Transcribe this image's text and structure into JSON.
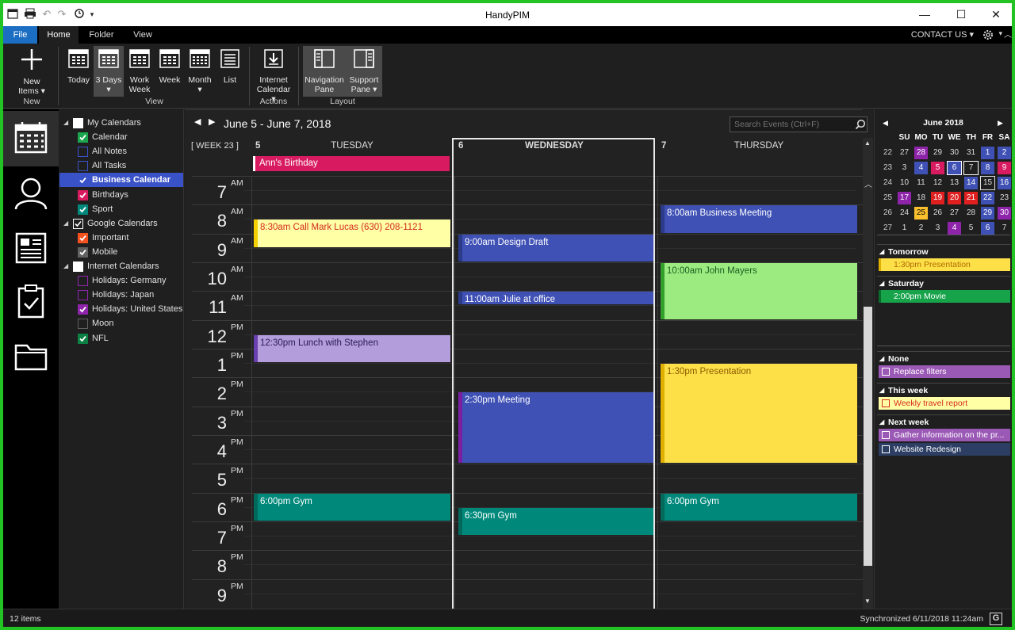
{
  "window": {
    "title": "HandyPIM",
    "controls": {
      "minimize": "—",
      "maximize": "☐",
      "close": "✕"
    }
  },
  "menu": {
    "tabs": {
      "file": "File",
      "home": "Home",
      "folder": "Folder",
      "view": "View"
    },
    "contact_us": "CONTACT US"
  },
  "ribbon": {
    "new_items_1": "New",
    "new_items_2": "Items",
    "new_group": "New",
    "today": "Today",
    "three_days": "3 Days",
    "work_week_1": "Work",
    "work_week_2": "Week",
    "week": "Week",
    "month": "Month",
    "list": "List",
    "view_group": "View",
    "internet_cal_1": "Internet",
    "internet_cal_2": "Calendar",
    "actions_group": "Actions",
    "nav_pane_1": "Navigation",
    "nav_pane_2": "Pane",
    "support_pane_1": "Support",
    "support_pane_2": "Pane",
    "layout_group": "Layout"
  },
  "calendars": [
    {
      "label": "My Calendars",
      "group": true,
      "checked": false,
      "color": "#ffffff"
    },
    {
      "label": "Calendar",
      "checked": true,
      "color": "#19a64e"
    },
    {
      "label": "All Notes",
      "checked": false,
      "color": "#3a52c7"
    },
    {
      "label": "All Tasks",
      "checked": false,
      "color": "#3a52c7"
    },
    {
      "label": "Business Calendar",
      "checked": true,
      "color": "#3a52c7",
      "selected": true
    },
    {
      "label": "Birthdays",
      "checked": true,
      "color": "#d81b60"
    },
    {
      "label": "Sport",
      "checked": true,
      "color": "#00897b"
    },
    {
      "label": "Google Calendars",
      "group": true,
      "checked": true,
      "color": "#ffffff"
    },
    {
      "label": "Important",
      "checked": true,
      "color": "#f4511e"
    },
    {
      "label": "Mobile",
      "checked": true,
      "color": "#616161"
    },
    {
      "label": "Internet Calendars",
      "group": true,
      "checked": false,
      "color": "#ffffff"
    },
    {
      "label": "Holidays: Germany",
      "checked": false,
      "color": "#8e24aa"
    },
    {
      "label": "Holidays: Japan",
      "checked": false,
      "color": "#8e24aa"
    },
    {
      "label": "Holidays: United States",
      "checked": true,
      "color": "#8e24aa"
    },
    {
      "label": "Moon",
      "checked": false,
      "color": "#616161"
    },
    {
      "label": "NFL",
      "checked": true,
      "color": "#0b8043"
    }
  ],
  "main": {
    "date_range": "June 5 - June 7, 2018",
    "search_placeholder": "Search Events (Ctrl+F)",
    "week_label": "[ WEEK 23 ]",
    "days": [
      {
        "num": "5",
        "name": "TUESDAY"
      },
      {
        "num": "6",
        "name": "WEDNESDAY"
      },
      {
        "num": "7",
        "name": "THURSDAY"
      }
    ],
    "hours": [
      {
        "num": "7",
        "ampm": "AM"
      },
      {
        "num": "8",
        "ampm": "AM"
      },
      {
        "num": "9",
        "ampm": "AM"
      },
      {
        "num": "10",
        "ampm": "AM"
      },
      {
        "num": "11",
        "ampm": "AM"
      },
      {
        "num": "12",
        "ampm": "PM"
      },
      {
        "num": "1",
        "ampm": "PM"
      },
      {
        "num": "2",
        "ampm": "PM"
      },
      {
        "num": "3",
        "ampm": "PM"
      },
      {
        "num": "4",
        "ampm": "PM"
      },
      {
        "num": "5",
        "ampm": "PM"
      },
      {
        "num": "6",
        "ampm": "PM"
      },
      {
        "num": "7",
        "ampm": "PM"
      },
      {
        "num": "8",
        "ampm": "PM"
      },
      {
        "num": "9",
        "ampm": "PM"
      }
    ],
    "all_day_event": "Ann's Birthday",
    "events": [
      {
        "label": "8:30am Call Mark Lucas  (630) 208-1121",
        "bg": "#ffffa6",
        "fg": "#d42a1c",
        "stripe": "#f5d000"
      },
      {
        "label": "12:30pm Lunch with Stephen",
        "bg": "#b39ddb",
        "fg": "#2a1a55",
        "stripe": "#6a3fb0"
      },
      {
        "label": "6:00pm Gym",
        "bg": "#00897b",
        "fg": "#ffffff",
        "stripe": "#00695c"
      },
      {
        "label": "9:00am Design Draft",
        "bg": "#3f51b5",
        "fg": "#ffffff",
        "stripe": "#2c3a8a"
      },
      {
        "label": "11:00am Julie at office",
        "bg": "#3f51b5",
        "fg": "#ffffff",
        "stripe": "#2c3a8a"
      },
      {
        "label": "2:30pm Meeting",
        "bg": "#3f51b5",
        "fg": "#ffffff",
        "stripe": "#7b1fa2"
      },
      {
        "label": "6:30pm Gym",
        "bg": "#00897b",
        "fg": "#ffffff",
        "stripe": "#00695c"
      },
      {
        "label": "8:00am Business Meeting",
        "bg": "#3f51b5",
        "fg": "#ffffff",
        "stripe": "#2c3a8a"
      },
      {
        "label": "10:00am John Mayers",
        "bg": "#9ceb81",
        "fg": "#1b5e20",
        "stripe": "#33a02c"
      },
      {
        "label": "1:30pm Presentation",
        "bg": "#fde047",
        "fg": "#8a5a00",
        "stripe": "#e0b000"
      },
      {
        "label": "6:00pm Gym",
        "bg": "#00897b",
        "fg": "#ffffff",
        "stripe": "#00695c"
      }
    ]
  },
  "mini_calendar": {
    "title": "June 2018",
    "weekdays": [
      "SU",
      "MO",
      "TU",
      "WE",
      "TH",
      "FR",
      "SA"
    ],
    "weeks": [
      {
        "wk": "22",
        "days": [
          "27",
          "28",
          "29",
          "30",
          "31",
          "1",
          "2"
        ]
      },
      {
        "wk": "23",
        "days": [
          "3",
          "4",
          "5",
          "6",
          "7",
          "8",
          "9"
        ]
      },
      {
        "wk": "24",
        "days": [
          "10",
          "11",
          "12",
          "13",
          "14",
          "15",
          "16"
        ]
      },
      {
        "wk": "25",
        "days": [
          "17",
          "18",
          "19",
          "20",
          "21",
          "22",
          "23"
        ]
      },
      {
        "wk": "26",
        "days": [
          "24",
          "25",
          "26",
          "27",
          "28",
          "29",
          "30"
        ]
      },
      {
        "wk": "27",
        "days": [
          "1",
          "2",
          "3",
          "4",
          "5",
          "6",
          "7"
        ]
      }
    ]
  },
  "upcoming": {
    "tomorrow": "Tomorrow",
    "tomorrow_item": "1:30pm   Presentation",
    "saturday": "Saturday",
    "saturday_item": "2:00pm   Movie"
  },
  "tasks": {
    "none": "None",
    "none_item": "Replace filters",
    "this_week": "This week",
    "this_week_item": "Weekly travel report",
    "next_week": "Next week",
    "next_week_item_1": "Gather information on the pr...",
    "next_week_item_2": "Website Redesign"
  },
  "status": {
    "items": "12 items",
    "sync": "Synchronized 6/11/2018 11:24am",
    "sync_icon": "G"
  }
}
